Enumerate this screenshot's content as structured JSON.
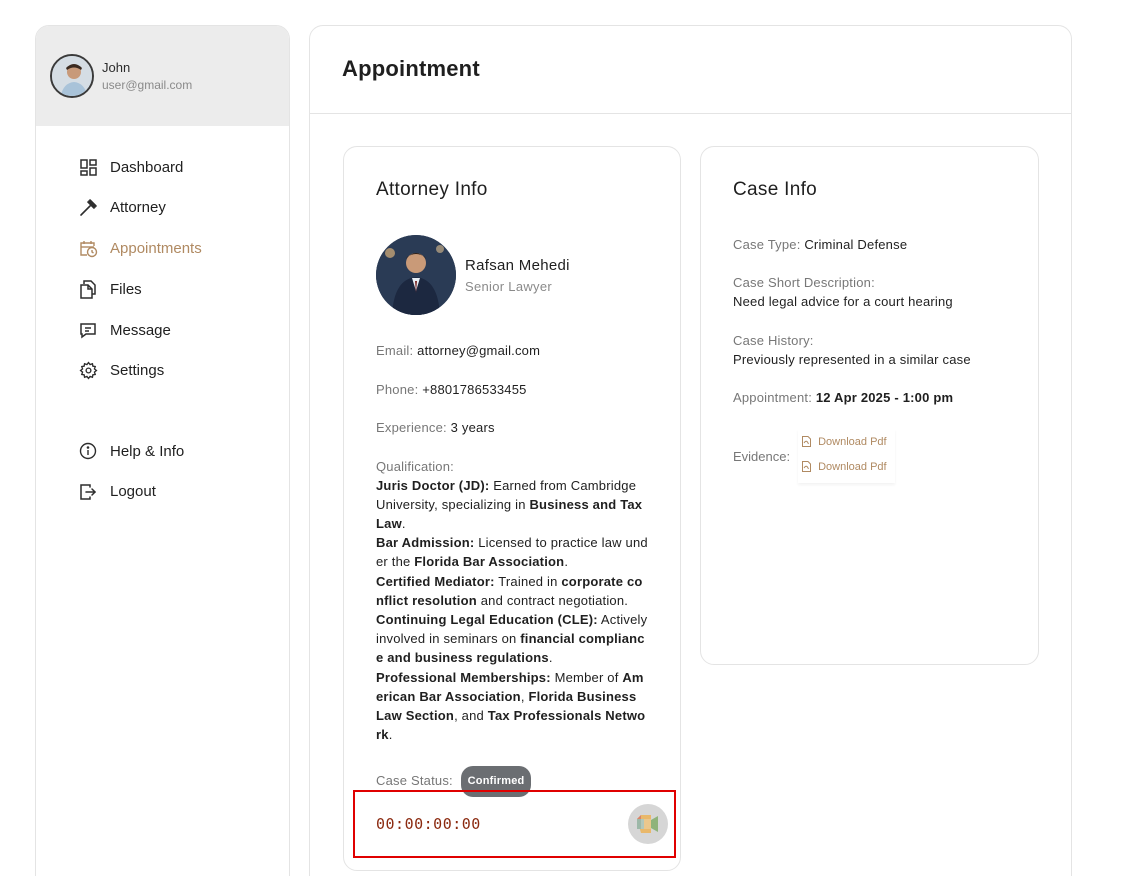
{
  "sidebar": {
    "user_name": "John",
    "user_email": "user@gmail.com",
    "items": [
      {
        "label": "Dashboard",
        "icon": "dashboard-icon"
      },
      {
        "label": "Attorney",
        "icon": "gavel-icon"
      },
      {
        "label": "Appointments",
        "icon": "calendar-clock-icon"
      },
      {
        "label": "Files",
        "icon": "files-icon"
      },
      {
        "label": "Message",
        "icon": "message-icon"
      },
      {
        "label": "Settings",
        "icon": "gear-icon"
      }
    ],
    "bottom_items": [
      {
        "label": "Help & Info",
        "icon": "info-icon"
      },
      {
        "label": "Logout",
        "icon": "logout-icon"
      }
    ],
    "active_item": "Appointments"
  },
  "page": {
    "title": "Appointment"
  },
  "attorney": {
    "card_title": "Attorney Info",
    "name": "Rafsan Mehedi",
    "role": "Senior Lawyer",
    "email_label": "Email:",
    "email": "attorney@gmail.com",
    "phone_label": "Phone:",
    "phone": "+8801786533455",
    "experience_label": "Experience:",
    "experience": "3 years",
    "qualification_label": "Qualification:",
    "qualifications": [
      {
        "head": "Juris Doctor (JD):",
        "parts": [
          " Earned from Cambridge University, specializing in ",
          "Business and Tax Law",
          "."
        ]
      },
      {
        "head": "Bar Admission:",
        "parts": [
          " Licensed to practice law under the ",
          "Florida Bar Association",
          "."
        ]
      },
      {
        "head": "Certified Mediator:",
        "parts": [
          " Trained in ",
          "corporate conflict resolution",
          " and contract negotiation."
        ]
      },
      {
        "head": "Continuing Legal Education (CLE):",
        "parts": [
          " Actively involved in seminars on ",
          "financial compliance and business regulations",
          "."
        ]
      },
      {
        "head": "Professional Memberships:",
        "parts": [
          " Member of ",
          "American Bar Association",
          ", ",
          "Florida Business Law Section",
          ", and ",
          "Tax Professionals Network",
          "."
        ]
      }
    ],
    "status_label": "Case Status:",
    "status": "Confirmed",
    "timer": "00:00:00:00",
    "status_color": "#6b6e72"
  },
  "case": {
    "card_title": "Case Info",
    "type_label": "Case Type:",
    "type": "Criminal Defense",
    "desc_label": "Case Short Description:",
    "desc": "Need legal advice for a court hearing",
    "history_label": "Case History:",
    "history": "Previously represented in a similar case",
    "appointment_label": "Appointment:",
    "appointment": "12 Apr 2025 - 1:00 pm",
    "evidence_label": "Evidence:",
    "evidence": [
      "Download Pdf",
      "Download Pdf"
    ]
  },
  "colors": {
    "accent": "#b08a62",
    "highlight_border": "#e00000",
    "timer": "#8b2a10"
  }
}
